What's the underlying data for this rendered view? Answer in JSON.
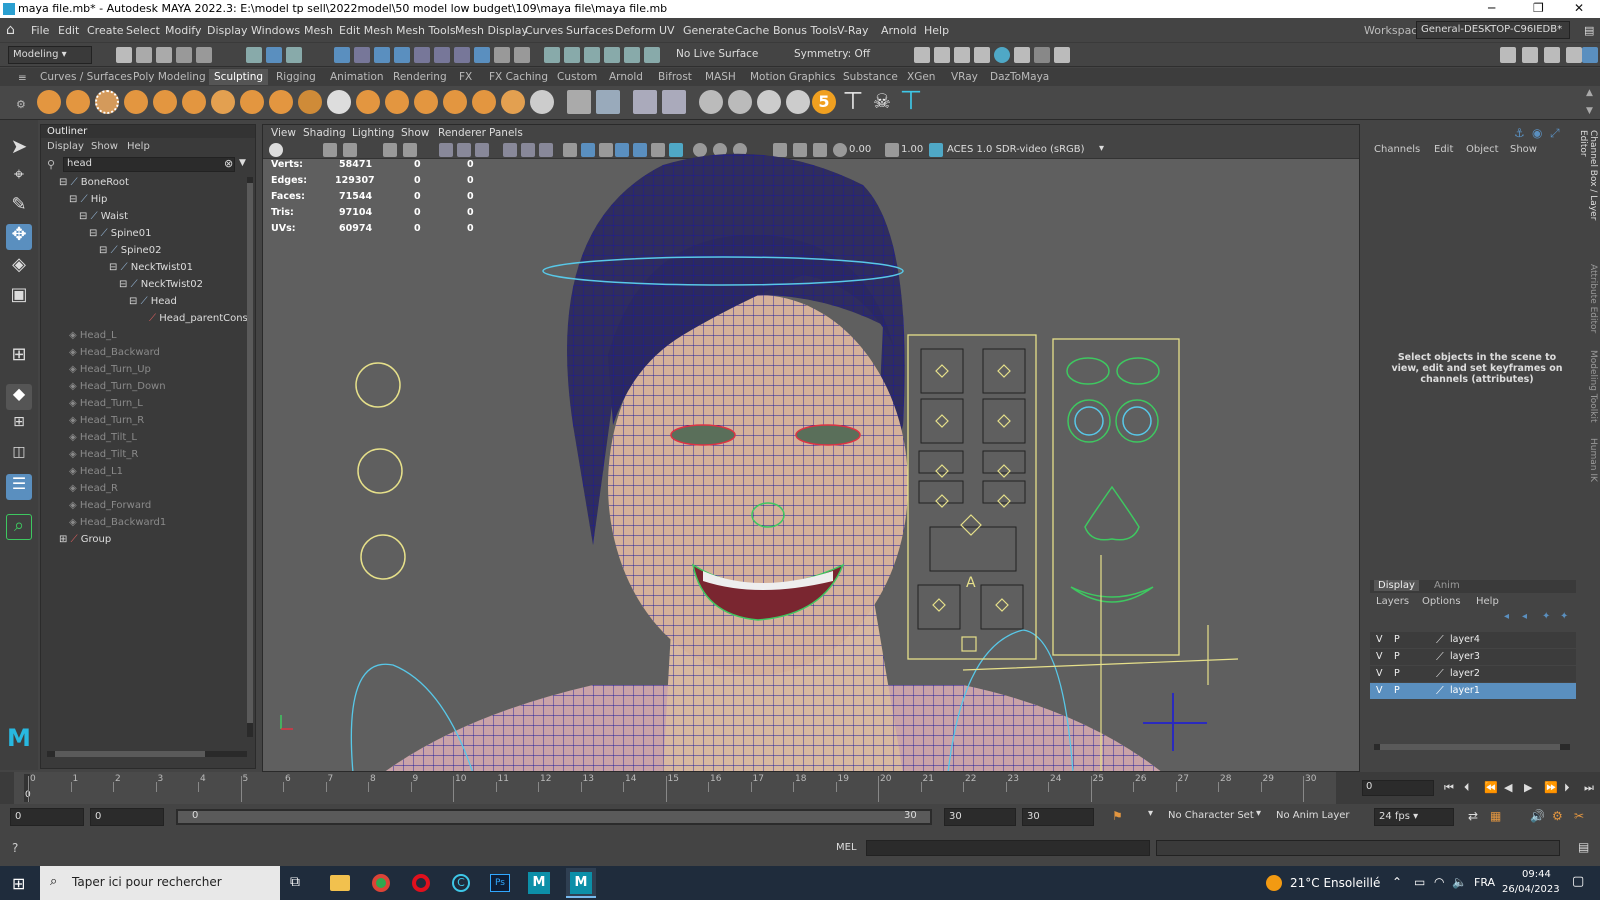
{
  "window": {
    "title": "maya file.mb* - Autodesk MAYA 2022.3: E:\\model tp sell\\2022model\\50 model low budget\\109\\maya file\\maya file.mb"
  },
  "menubar": {
    "items": [
      "File",
      "Edit",
      "Create",
      "Select",
      "Modify",
      "Display",
      "Windows",
      "Mesh",
      "Edit Mesh",
      "Mesh Tools",
      "Mesh Display",
      "Curves",
      "Surfaces",
      "Deform",
      "UV",
      "Generate",
      "Cache",
      "Bonus Tools",
      "V-Ray",
      "Arnold",
      "Help"
    ],
    "workspace_label": "Workspace:",
    "workspace_value": "General-DESKTOP-C96IEDB*"
  },
  "statusline": {
    "mode": "Modeling",
    "live_surface": "No Live Surface",
    "symmetry": "Symmetry: Off"
  },
  "shelf": {
    "tabs": [
      "Curves / Surfaces",
      "Poly Modeling",
      "Sculpting",
      "Rigging",
      "Animation",
      "Rendering",
      "FX",
      "FX Caching",
      "Custom",
      "Arnold",
      "Bifrost",
      "MASH",
      "Motion Graphics",
      "Substance",
      "XGen",
      "VRay",
      "DazToMaya"
    ],
    "active": "Sculpting",
    "badge": "5"
  },
  "outliner": {
    "title": "Outliner",
    "menu": [
      "Display",
      "Show",
      "Help"
    ],
    "search": "head",
    "joints": [
      "BoneRoot",
      "Hip",
      "Waist",
      "Spine01",
      "Spine02",
      "NeckTwist01",
      "NeckTwist02",
      "Head"
    ],
    "constraint": "Head_parentConst",
    "shapes": [
      "Head_L",
      "Head_Backward",
      "Head_Turn_Up",
      "Head_Turn_Down",
      "Head_Turn_L",
      "Head_Turn_R",
      "Head_Tilt_L",
      "Head_Tilt_R",
      "Head_L1",
      "Head_R",
      "Head_Forward",
      "Head_Backward1"
    ],
    "group": "Group"
  },
  "viewport": {
    "menu": [
      "View",
      "Shading",
      "Lighting",
      "Show",
      "Renderer",
      "Panels"
    ],
    "field1": "0.00",
    "field2": "1.00",
    "colorspace": "ACES 1.0 SDR-video (sRGB)",
    "hud": [
      {
        "label": "Verts:",
        "v1": "58471",
        "v2": "0",
        "v3": "0"
      },
      {
        "label": "Edges:",
        "v1": "129307",
        "v2": "0",
        "v3": "0"
      },
      {
        "label": "Faces:",
        "v1": "71544",
        "v2": "0",
        "v3": "0"
      },
      {
        "label": "Tris:",
        "v1": "97104",
        "v2": "0",
        "v3": "0"
      },
      {
        "label": "UVs:",
        "v1": "60974",
        "v2": "0",
        "v3": "0"
      }
    ],
    "ctrl_letter": "A"
  },
  "channelbox": {
    "menu": [
      "Channels",
      "Edit",
      "Object",
      "Show"
    ],
    "message": "Select objects in the scene to view, edit and set keyframes on channels (attributes)",
    "side_tabs": [
      "Channel Box / Layer Editor",
      "Attribute Editor",
      "Modeling Toolkit",
      "Human IK"
    ],
    "layer_tabs": [
      "Display",
      "Anim"
    ],
    "layer_menu": [
      "Layers",
      "Options",
      "Help"
    ],
    "layers": [
      {
        "v": "V",
        "p": "P",
        "name": "layer4",
        "selected": false
      },
      {
        "v": "V",
        "p": "P",
        "name": "layer3",
        "selected": false
      },
      {
        "v": "V",
        "p": "P",
        "name": "layer2",
        "selected": false
      },
      {
        "v": "V",
        "p": "P",
        "name": "layer1",
        "selected": true
      }
    ]
  },
  "timeline": {
    "ticks": [
      "0",
      "1",
      "2",
      "3",
      "4",
      "5",
      "6",
      "7",
      "8",
      "9",
      "10",
      "11",
      "12",
      "13",
      "14",
      "15",
      "16",
      "17",
      "18",
      "19",
      "20",
      "21",
      "22",
      "23",
      "24",
      "25",
      "26",
      "27",
      "28",
      "29",
      "30"
    ],
    "current": "0",
    "current_frame_field": "0"
  },
  "range": {
    "start": "0",
    "start2": "0",
    "slider_start": "0",
    "slider_end": "30",
    "end": "30",
    "end2": "30",
    "character_set": "No Character Set",
    "anim_layer": "No Anim Layer",
    "fps": "24 fps"
  },
  "cmdline": {
    "lang": "MEL"
  },
  "taskbar": {
    "search_placeholder": "Taper ici pour rechercher",
    "weather": "21°C Ensoleillé",
    "lang": "FRA",
    "time": "09:44",
    "date": "26/04/2023"
  },
  "colors": {
    "accent": "#5a8fbf",
    "wire": "#1c1a9a",
    "ctrl": "#e6e08a"
  }
}
